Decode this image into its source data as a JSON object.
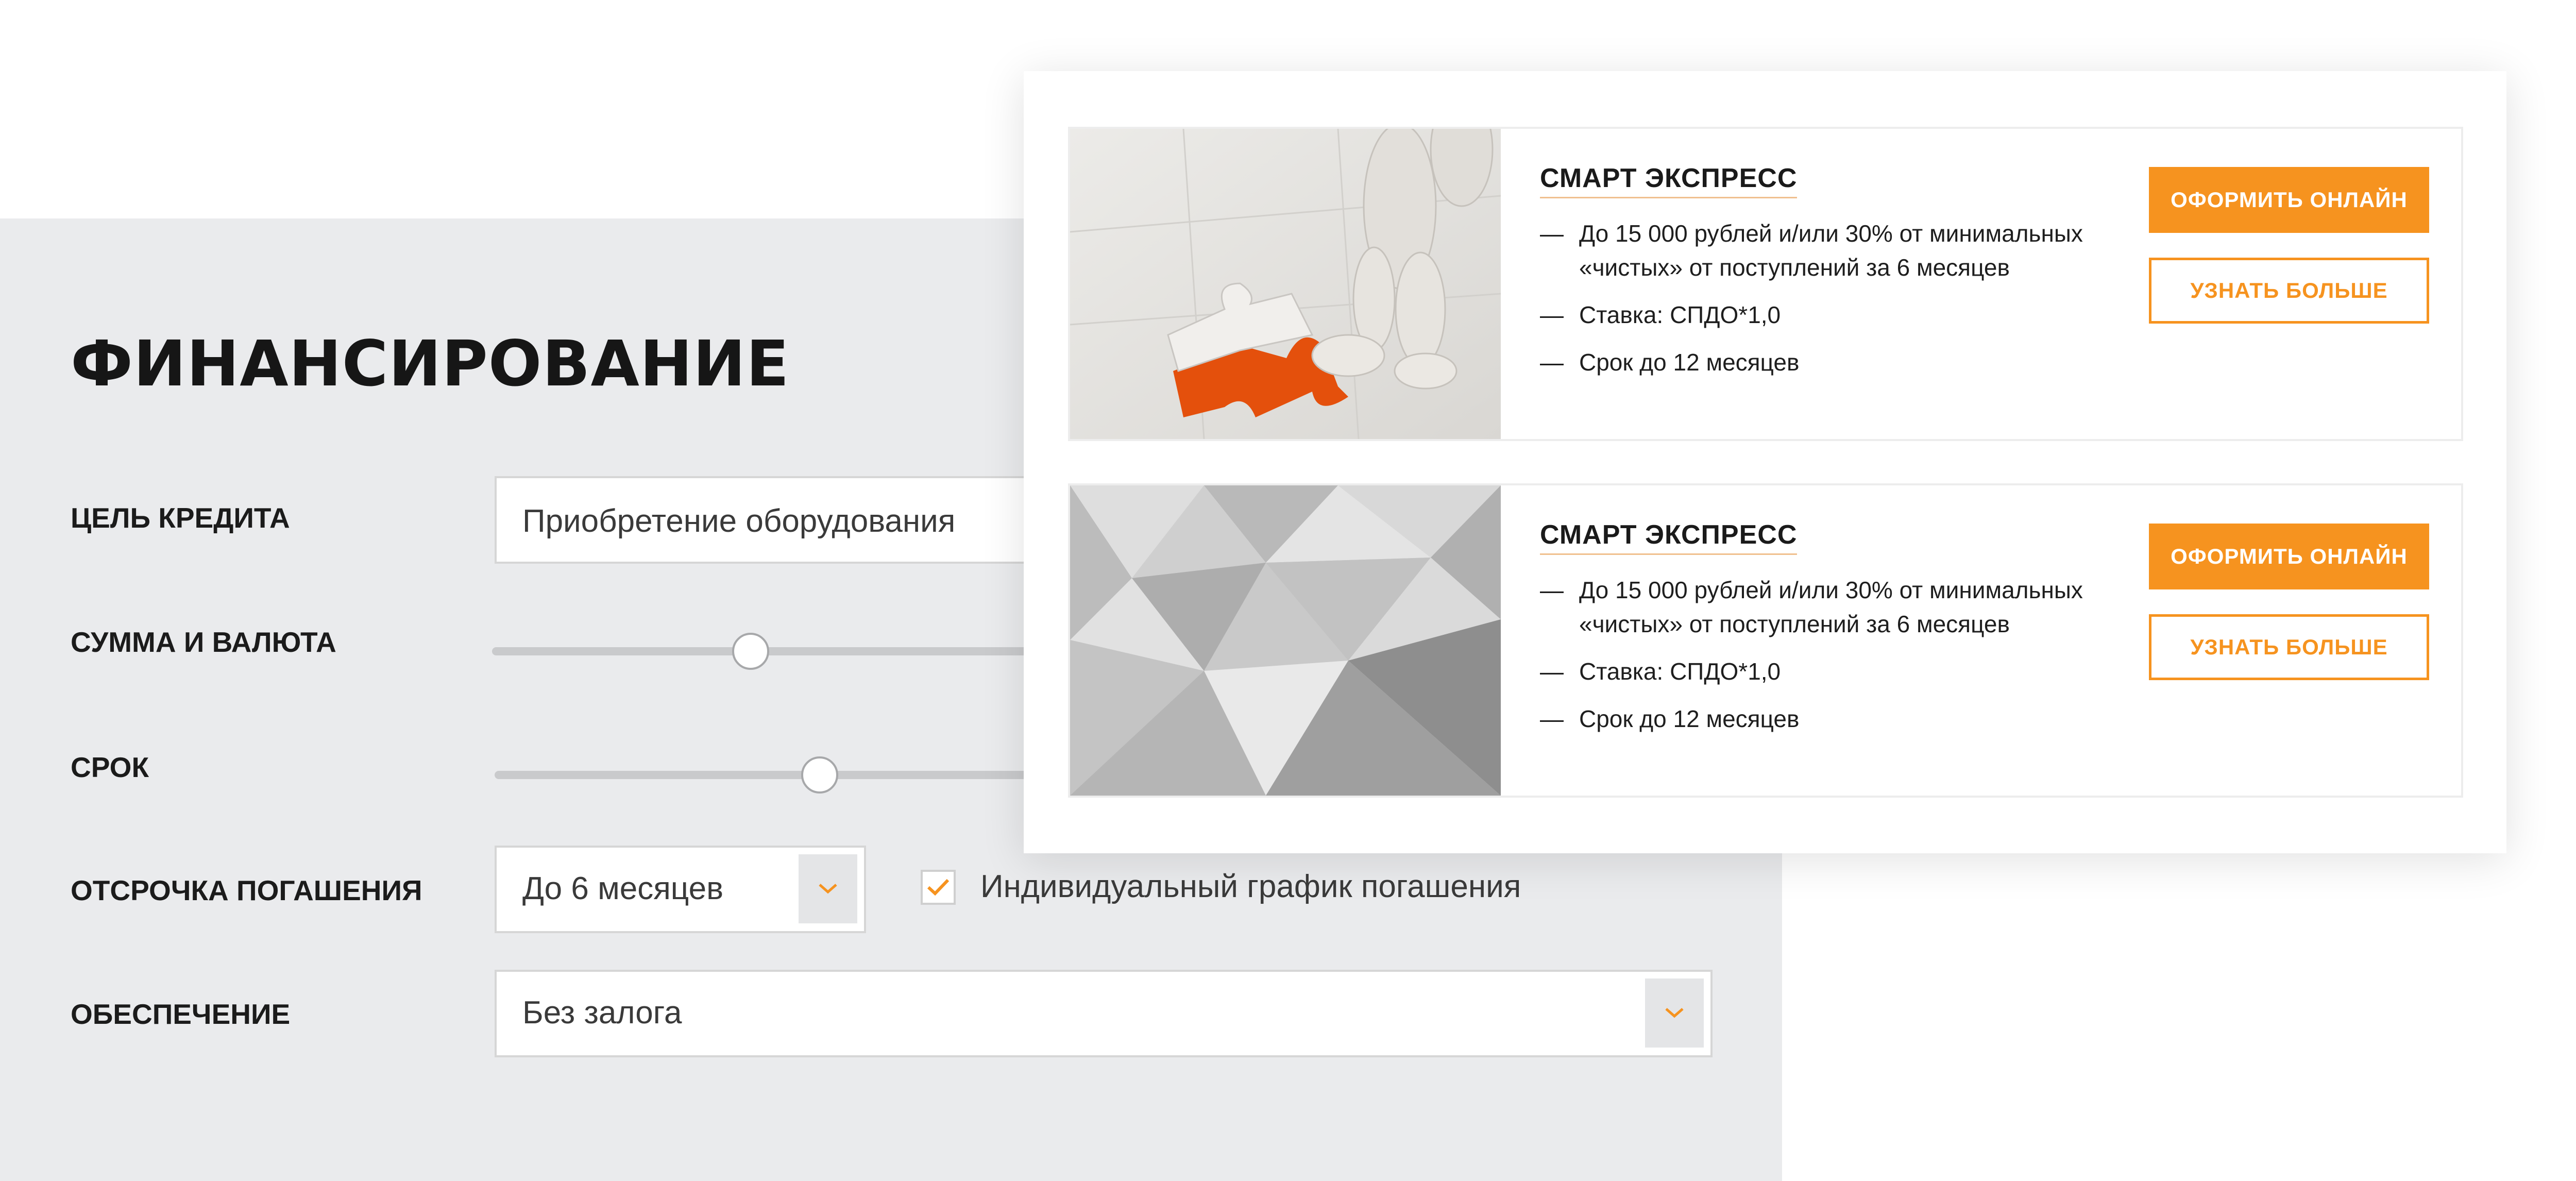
{
  "form": {
    "title": "ФИНАНСИРОВАНИЕ",
    "rows": {
      "purpose": {
        "label": "ЦЕЛЬ КРЕДИТА",
        "value": "Приобретение оборудования"
      },
      "amount": {
        "label": "СУММА И ВАЛЮТА",
        "slider_level_percent": 29
      },
      "term": {
        "label": "СРОК",
        "slider_level_percent": 37
      },
      "deferral": {
        "label": "ОТСРОЧКА ПОГАШЕНИЯ",
        "value": "До 6 месяцев",
        "checkbox_label": "Индивидуальный график погашения",
        "checkbox_checked": true
      },
      "collateral": {
        "label": "ОБЕСПЕЧЕНИЕ",
        "value": "Без залога"
      }
    }
  },
  "offers": [
    {
      "title": "СМАРТ ЭКСПРЕСС",
      "image": "puzzle-figure-image",
      "features": [
        "До 15 000 рублей и/или 30% от минимальных «чистых» от поступлений за 6 месяцев",
        "Ставка: СПДО*1,0",
        "Срок до 12 месяцев"
      ],
      "primary_label": "ОФОРМИТЬ ОНЛАЙН",
      "secondary_label": "УЗНАТЬ БОЛЬШЕ"
    },
    {
      "title": "СМАРТ ЭКСПРЕСС",
      "image": "geometric-pattern-image",
      "features": [
        "До 15 000 рублей и/или 30% от минимальных «чистых» от поступлений за 6 месяцев",
        "Ставка: СПДО*1,0",
        "Срок до 12 месяцев"
      ],
      "primary_label": "ОФОРМИТЬ ОНЛАЙН",
      "secondary_label": "УЗНАТЬ БОЛЬШЕ"
    }
  ],
  "dash": "—",
  "colors": {
    "accent": "#f6931f",
    "panel": "#eaebed",
    "text": "#1c1c1c"
  }
}
